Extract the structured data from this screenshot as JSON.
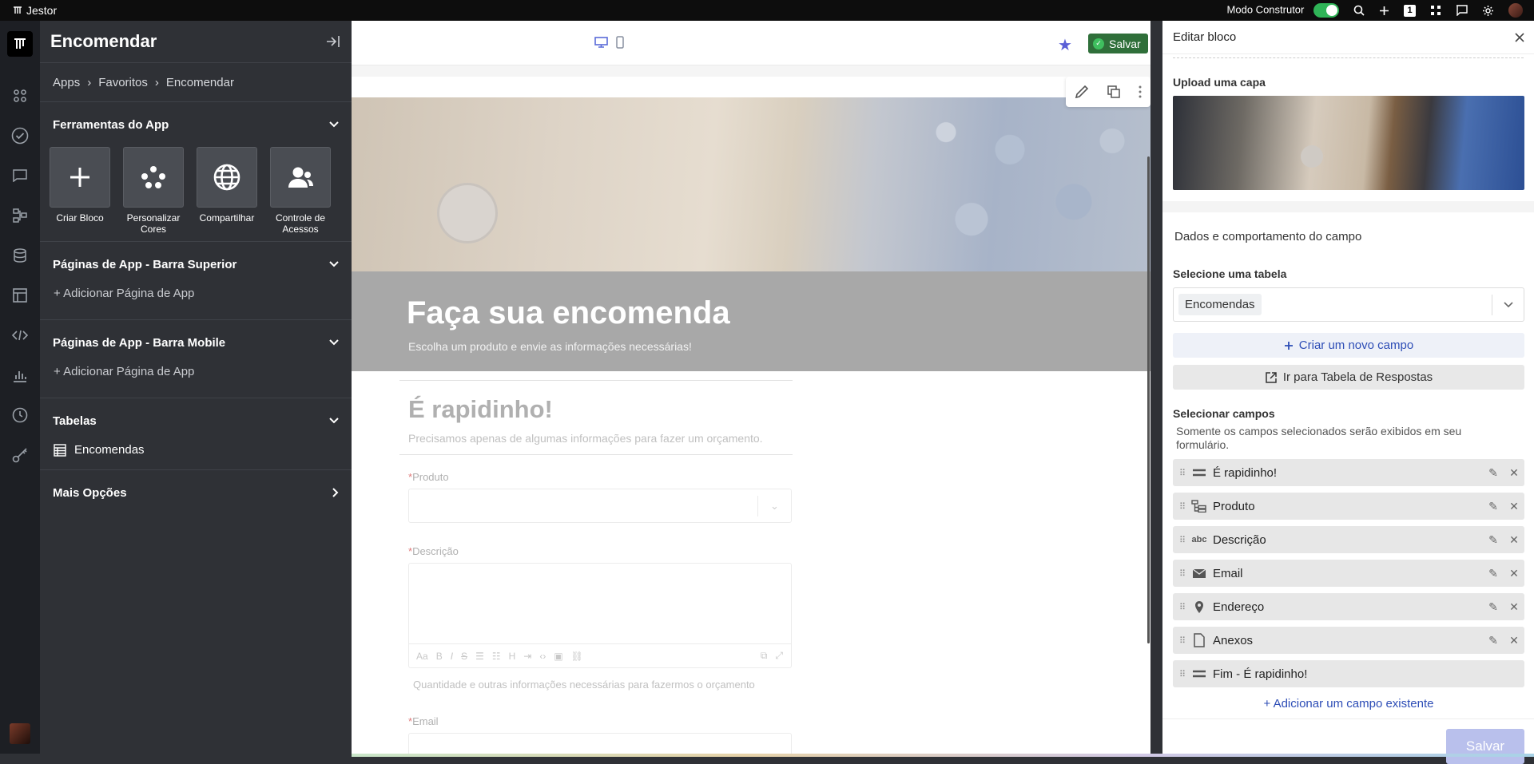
{
  "topbar": {
    "app_name": "Jestor",
    "builder_mode_label": "Modo Construtor",
    "notification_count": "1"
  },
  "sidebar": {
    "title": "Encomendar",
    "breadcrumb": [
      "Apps",
      "Favoritos",
      "Encomendar"
    ],
    "tools_section": "Ferramentas do App",
    "tools": [
      {
        "label": "Criar Bloco"
      },
      {
        "label": "Personalizar Cores"
      },
      {
        "label": "Compartilhar"
      },
      {
        "label": "Controle de Acessos"
      }
    ],
    "top_pages_section": "Páginas de App - Barra Superior",
    "top_pages_add": "+ Adicionar Página de App",
    "mobile_pages_section": "Páginas de App - Barra Mobile",
    "mobile_pages_add": "+ Adicionar Página de App",
    "tables_section": "Tabelas",
    "tables": [
      "Encomendas"
    ],
    "more_section": "Mais Opções"
  },
  "canvas": {
    "save_label": "Salvar",
    "banner_title": "Faça sua encomenda",
    "banner_subtitle": "Escolha um produto e envie as informações necessárias!",
    "form_title": "É rapidinho!",
    "form_subtitle": "Precisamos apenas de algumas informações para fazer um orçamento.",
    "fields": {
      "produto": "Produto",
      "descricao": "Descrição",
      "email": "Email"
    },
    "rte_format_label": "Aa",
    "descricao_hint": "Quantidade e outras informações necessárias para fazermos o orçamento"
  },
  "panel": {
    "title": "Editar bloco",
    "upload_cover_label": "Upload uma capa",
    "data_section": "Dados e comportamento do campo",
    "select_table_label": "Selecione uma tabela",
    "selected_table": "Encomendas",
    "create_field_button": "Criar um novo campo",
    "go_to_responses_button": "Ir para Tabela de Respostas",
    "select_fields_label": "Selecionar campos",
    "select_fields_desc": "Somente os campos selecionados serão exibidos em seu formulário.",
    "field_rows": [
      {
        "label": "É rapidinho!",
        "icon": "section-icon",
        "editable": true
      },
      {
        "label": "Produto",
        "icon": "relation-icon",
        "editable": true
      },
      {
        "label": "Descrição",
        "icon": "text-abc-icon",
        "editable": true
      },
      {
        "label": "Email",
        "icon": "email-icon",
        "editable": true
      },
      {
        "label": "Endereço",
        "icon": "location-pin-icon",
        "editable": true
      },
      {
        "label": "Anexos",
        "icon": "file-icon",
        "editable": true
      },
      {
        "label": "Fim - É rapidinho!",
        "icon": "section-icon",
        "editable": false
      }
    ],
    "text_icon_label": "abc",
    "add_existing_field": "+ Adicionar um campo existente",
    "save_label": "Salvar"
  },
  "colors": {
    "accent": "#5b5fd6",
    "save_green": "#2f6f3a",
    "sidebar_bg": "#2f3136",
    "rail_bg": "#1d1f24",
    "link_blue": "#2d4db6",
    "save_disabled": "#b9c0ec"
  }
}
